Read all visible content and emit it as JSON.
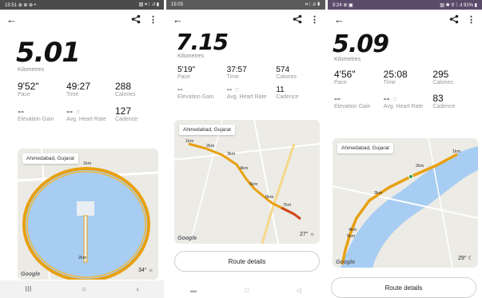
{
  "screens": [
    {
      "status": {
        "time": "15:51",
        "icons": "⊕ ⊕ ⊕ •",
        "right": "▨ ⌗ ⁞ .ıl ▮"
      },
      "distance": "5.01",
      "unit": "Kilometres",
      "stats": [
        {
          "value": "9'52\"",
          "label": "Pace"
        },
        {
          "value": "49:27",
          "label": "Time"
        },
        {
          "value": "288",
          "label": "Calories"
        },
        {
          "value": "--",
          "label": "Elevation Gain"
        },
        {
          "value": "--",
          "label": "Avg. Heart Rate",
          "icon": "heart-icon"
        },
        {
          "value": "127",
          "label": "Cadence"
        }
      ],
      "map": {
        "label": "Ahmedabad, Gujarat",
        "weather_temp": "34°",
        "weather_icon": "sun-icon",
        "attribution": "Google",
        "km_markers": [
          "1km",
          "2km"
        ]
      },
      "nav": [
        "III",
        "○",
        "‹"
      ]
    },
    {
      "status": {
        "time": "15:03",
        "icons": "",
        "right": "⌗ ⁞ .ıl ▮"
      },
      "distance": "7.15",
      "unit": "Kilometres",
      "stats": [
        {
          "value": "5'19\"",
          "label": "Pace"
        },
        {
          "value": "37:57",
          "label": "Time"
        },
        {
          "value": "574",
          "label": "Calories"
        },
        {
          "value": "--",
          "label": "Elevation Gain"
        },
        {
          "value": "--",
          "label": "Avg. Heart Rate",
          "icon": "heart-icon"
        },
        {
          "value": "11",
          "label": "Cadence"
        }
      ],
      "map": {
        "label": "Ahmedabad, Gujarat",
        "weather_temp": "27°",
        "weather_icon": "sun-icon",
        "attribution": "Google",
        "km_markers": [
          "1km",
          "2km",
          "3km",
          "4km",
          "5km",
          "6km",
          "7km"
        ]
      },
      "route_button": "Route details",
      "nav": [
        "▬",
        "□",
        "◁"
      ]
    },
    {
      "status": {
        "time": "9:24",
        "icons": "⊕ ▣",
        "right": "▨ ✱ ⚲ ⁞ .ıl 91% ▮"
      },
      "distance": "5.09",
      "unit": "Kilometres",
      "stats": [
        {
          "value": "4'56\"",
          "label": "Pace"
        },
        {
          "value": "25:08",
          "label": "Time"
        },
        {
          "value": "295",
          "label": "Calories"
        },
        {
          "value": "--",
          "label": "Elevation Gain"
        },
        {
          "value": "--",
          "label": "Avg. Heart Rate",
          "icon": "heart-icon"
        },
        {
          "value": "83",
          "label": "Cadence"
        }
      ],
      "map": {
        "label": "Ahmedabad, Gujarat",
        "weather_temp": "29°",
        "weather_icon": "moon-icon",
        "attribution": "Google",
        "km_markers": [
          "1km",
          "2km",
          "3km",
          "4km",
          "5km"
        ]
      },
      "route_button": "Route details"
    }
  ],
  "colors": {
    "route": "#e8a010",
    "route_end": "#d0451b",
    "water": "#a7cdf2",
    "land": "#eceae4",
    "road": "#f7d78c"
  }
}
